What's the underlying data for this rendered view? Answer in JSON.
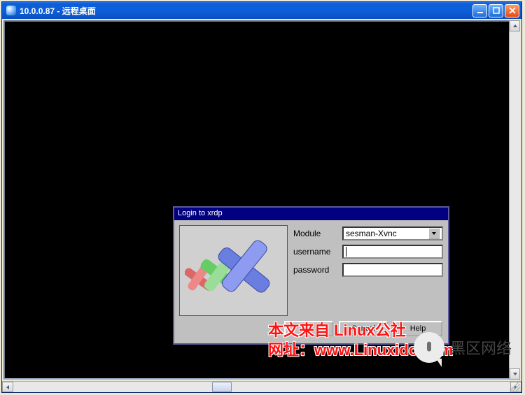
{
  "window": {
    "title": "10.0.0.87 - 远程桌面"
  },
  "login_dialog": {
    "title": "Login to xrdp",
    "labels": {
      "module": "Module",
      "username": "username",
      "password": "password"
    },
    "module_value": "sesman-Xvnc",
    "username_value": "",
    "password_value": "",
    "buttons": {
      "ok": "OK",
      "cancel": "Cancel",
      "help": "Help"
    }
  },
  "watermark": {
    "line1": "本文来自 Linux公社",
    "line2": "网址：www.Linuxidc.com"
  },
  "corner_logo_text": "黑区网络"
}
